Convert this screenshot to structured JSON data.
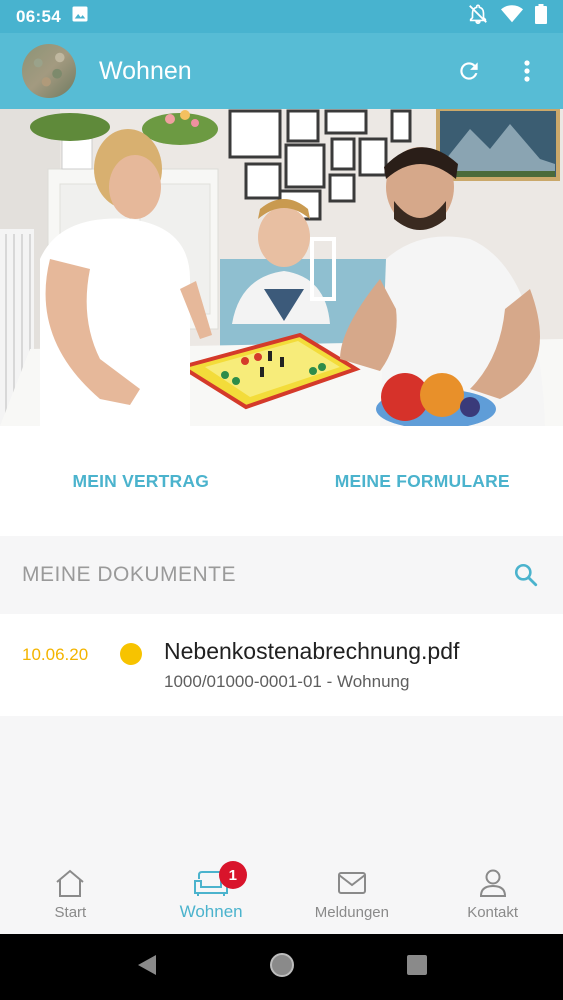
{
  "status_bar": {
    "time": "06:54",
    "icons": [
      "image-icon",
      "notifications-off-icon",
      "wifi-icon",
      "battery-icon"
    ]
  },
  "app_bar": {
    "title": "Wohnen",
    "actions": [
      "refresh-icon",
      "more-vert-icon"
    ]
  },
  "links": {
    "left": "MEIN VERTRAG",
    "right": "MEINE FORMULARE"
  },
  "documents": {
    "header": "MEINE DOKUMENTE",
    "items": [
      {
        "date": "10.06.20",
        "status_color": "#f7c300",
        "filename": "Nebenkostenabrechnung.pdf",
        "subtitle": "1000/01000-0001-01 - Wohnung"
      }
    ]
  },
  "bottom_nav": {
    "items": [
      {
        "label": "Start",
        "icon": "home-icon"
      },
      {
        "label": "Wohnen",
        "icon": "sofa-icon",
        "badge": "1",
        "active": true
      },
      {
        "label": "Meldungen",
        "icon": "mail-icon"
      },
      {
        "label": "Kontakt",
        "icon": "person-icon"
      }
    ]
  },
  "colors": {
    "primary": "#57bcd5",
    "status_bar": "#48b3cf",
    "accent": "#4bb3cd",
    "date": "#f3b400",
    "badge": "#d9142b"
  }
}
